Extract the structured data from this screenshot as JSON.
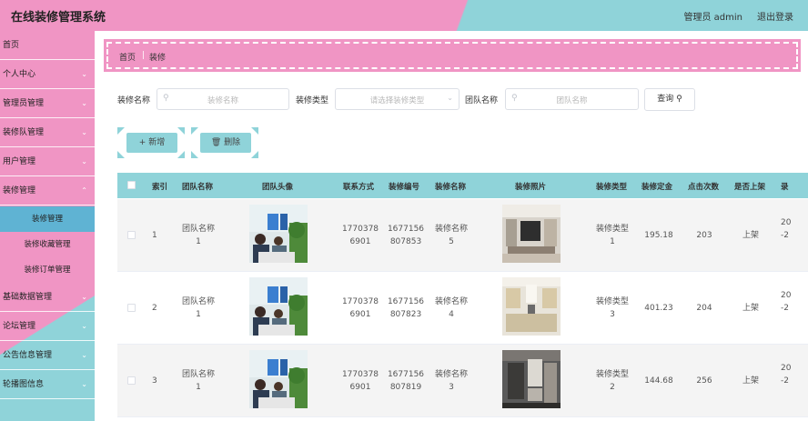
{
  "header": {
    "title": "在线装修管理系统",
    "user": "管理员 admin",
    "logout": "退出登录"
  },
  "sidebar": {
    "items": [
      {
        "label": "首页"
      },
      {
        "label": "个人中心"
      },
      {
        "label": "管理员管理"
      },
      {
        "label": "装修队管理"
      },
      {
        "label": "用户管理"
      },
      {
        "label": "装修管理"
      }
    ],
    "subitems": [
      {
        "label": "装修管理"
      },
      {
        "label": "装修收藏管理"
      },
      {
        "label": "装修订单管理"
      }
    ],
    "items2": [
      {
        "label": "基础数据管理"
      },
      {
        "label": "论坛管理"
      },
      {
        "label": "公告信息管理"
      },
      {
        "label": "轮播图信息"
      }
    ]
  },
  "breadcrumb": {
    "home": "首页",
    "sep": "|",
    "current": "装修"
  },
  "search": {
    "name_label": "装修名称",
    "name_placeholder": "装修名称",
    "type_label": "装修类型",
    "type_placeholder": "请选择装修类型",
    "team_label": "团队名称",
    "team_placeholder": "团队名称",
    "query": "查询"
  },
  "actions": {
    "add": "新增",
    "delete": "删除"
  },
  "table": {
    "headers": [
      "索引",
      "团队名称",
      "团队头像",
      "联系方式",
      "装修编号",
      "装修名称",
      "装修照片",
      "装修类型",
      "装修定金",
      "点击次数",
      "是否上架",
      "录"
    ],
    "rows": [
      {
        "index": "1",
        "team1": "团队名称",
        "team2": "1",
        "phone1": "1770378",
        "phone2": "6901",
        "code1": "1677156",
        "code2": "807853",
        "name1": "装修名称",
        "name2": "5",
        "type1": "装修类型",
        "type2": "1",
        "deposit": "195.18",
        "clicks": "203",
        "shelf": "上架",
        "rec1": "20",
        "rec2": "-2"
      },
      {
        "index": "2",
        "team1": "团队名称",
        "team2": "1",
        "phone1": "1770378",
        "phone2": "6901",
        "code1": "1677156",
        "code2": "807823",
        "name1": "装修名称",
        "name2": "4",
        "type1": "装修类型",
        "type2": "3",
        "deposit": "401.23",
        "clicks": "204",
        "shelf": "上架",
        "rec1": "20",
        "rec2": "-2"
      },
      {
        "index": "3",
        "team1": "团队名称",
        "team2": "1",
        "phone1": "1770378",
        "phone2": "6901",
        "code1": "1677156",
        "code2": "807819",
        "name1": "装修名称",
        "name2": "3",
        "type1": "装修类型",
        "type2": "2",
        "deposit": "144.68",
        "clicks": "256",
        "shelf": "上架",
        "rec1": "20",
        "rec2": "-2"
      }
    ]
  },
  "colors": {
    "pink": "#f095c4",
    "teal": "#8fd3d9",
    "active": "#5fb3d3"
  }
}
